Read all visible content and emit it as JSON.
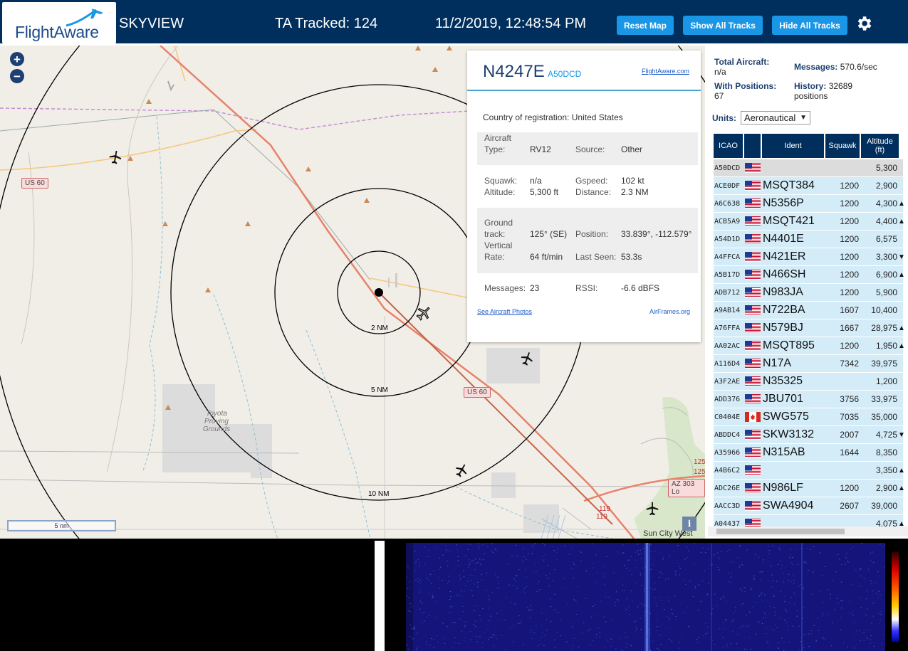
{
  "header": {
    "logo_text": "FlightAware",
    "title": "SKYVIEW",
    "tracked": "TA Tracked: 124",
    "datetime": "11/2/2019, 12:48:54 PM",
    "buttons": {
      "reset": "Reset Map",
      "show": "Show All Tracks",
      "hide": "Hide All Tracks"
    },
    "settings_icon": "gear-icon"
  },
  "map": {
    "zoom_in": "+",
    "zoom_out": "−",
    "range_labels": [
      "2 NM",
      "5 NM",
      "10 NM"
    ],
    "road_labels": [
      "US 60",
      "US 60",
      "AZ 303 Lo",
      "119",
      "119",
      "125",
      "125"
    ],
    "place_labels": [
      "Toyota Proving Grounds",
      "Sun City West"
    ],
    "scale": "5 nm",
    "info": "i"
  },
  "popup": {
    "ident": "N4247E",
    "hex": "A50DCD",
    "link": "FlightAware.com",
    "country_label": "Country of registration:",
    "country": "United States",
    "type_label1": "Aircraft",
    "type_label2": "Type:",
    "type": "RV12",
    "source_label": "Source:",
    "source": "Other",
    "squawk_label": "Squawk:",
    "squawk": "n/a",
    "gspeed_label": "Gspeed:",
    "gspeed": "102 kt",
    "altitude_label": "Altitude:",
    "altitude": "5,300 ft",
    "distance_label": "Distance:",
    "distance": "2.3 NM",
    "track_label1": "Ground",
    "track_label2": "track:",
    "track": "125° (SE)",
    "position_label": "Position:",
    "position": "33.839°, -112.579°",
    "vrate_label1": "Vertical",
    "vrate_label2": "Rate:",
    "vrate": "64 ft/min",
    "lastseen_label": "Last Seen:",
    "lastseen": "53.3s",
    "messages_label": "Messages:",
    "messages": "23",
    "rssi_label": "RSSI:",
    "rssi": "-6.6 dBFS",
    "photos": "See Aircraft Photos",
    "airframes": "AirFrames.org"
  },
  "stats": {
    "total_label": "Total Aircraft:",
    "total": "n/a",
    "messages_label": "Messages:",
    "messages": "570.6/sec",
    "positions_label": "With Positions:",
    "positions": "67",
    "history_label": "History:",
    "history": "32689",
    "history_unit": "positions",
    "units_label": "Units:",
    "units_value": "Aeronautical"
  },
  "table": {
    "headers": {
      "icao": "ICAO",
      "ident": "Ident",
      "squawk": "Squawk",
      "alt1": "Altitude",
      "alt2": "(ft)"
    },
    "rows": [
      {
        "icao": "A50DCD",
        "flag": "us",
        "ident": "",
        "squawk": "",
        "alt": "5,300",
        "trend": ""
      },
      {
        "icao": "ACE0DF",
        "flag": "us",
        "ident": "MSQT384",
        "squawk": "1200",
        "alt": "2,900",
        "trend": ""
      },
      {
        "icao": "A6C638",
        "flag": "us",
        "ident": "N5356P",
        "squawk": "1200",
        "alt": "4,300",
        "trend": "▲"
      },
      {
        "icao": "ACB5A9",
        "flag": "us",
        "ident": "MSQT421",
        "squawk": "1200",
        "alt": "4,400",
        "trend": "▲"
      },
      {
        "icao": "A54D1D",
        "flag": "us",
        "ident": "N4401E",
        "squawk": "1200",
        "alt": "6,575",
        "trend": ""
      },
      {
        "icao": "A4FFCA",
        "flag": "us",
        "ident": "N421ER",
        "squawk": "1200",
        "alt": "3,300",
        "trend": "▼"
      },
      {
        "icao": "A5B17D",
        "flag": "us",
        "ident": "N466SH",
        "squawk": "1200",
        "alt": "6,900",
        "trend": "▲"
      },
      {
        "icao": "ADB712",
        "flag": "us",
        "ident": "N983JA",
        "squawk": "1200",
        "alt": "5,900",
        "trend": ""
      },
      {
        "icao": "A9AB14",
        "flag": "us",
        "ident": "N722BA",
        "squawk": "1607",
        "alt": "10,400",
        "trend": ""
      },
      {
        "icao": "A76FFA",
        "flag": "us",
        "ident": "N579BJ",
        "squawk": "1667",
        "alt": "28,975",
        "trend": "▲"
      },
      {
        "icao": "AA02AC",
        "flag": "us",
        "ident": "MSQT895",
        "squawk": "1200",
        "alt": "1,950",
        "trend": "▲"
      },
      {
        "icao": "A116D4",
        "flag": "us",
        "ident": "N17A",
        "squawk": "7342",
        "alt": "39,975",
        "trend": ""
      },
      {
        "icao": "A3F2AE",
        "flag": "us",
        "ident": "N35325",
        "squawk": "",
        "alt": "1,200",
        "trend": ""
      },
      {
        "icao": "ADD376",
        "flag": "us",
        "ident": "JBU701",
        "squawk": "3756",
        "alt": "33,975",
        "trend": ""
      },
      {
        "icao": "C0404E",
        "flag": "ca",
        "ident": "SWG575",
        "squawk": "7035",
        "alt": "35,000",
        "trend": ""
      },
      {
        "icao": "ABDDC4",
        "flag": "us",
        "ident": "SKW3132",
        "squawk": "2007",
        "alt": "4,725",
        "trend": "▼"
      },
      {
        "icao": "A35966",
        "flag": "us",
        "ident": "N315AB",
        "squawk": "1644",
        "alt": "8,350",
        "trend": ""
      },
      {
        "icao": "A4B6C2",
        "flag": "us",
        "ident": "",
        "squawk": "",
        "alt": "3,350",
        "trend": "▲"
      },
      {
        "icao": "ADC26E",
        "flag": "us",
        "ident": "N986LF",
        "squawk": "1200",
        "alt": "2,900",
        "trend": "▲"
      },
      {
        "icao": "AACC3D",
        "flag": "us",
        "ident": "SWA4904",
        "squawk": "2607",
        "alt": "39,000",
        "trend": ""
      },
      {
        "icao": "A04437",
        "flag": "us",
        "ident": "",
        "squawk": "",
        "alt": "4,075",
        "trend": "▲"
      }
    ]
  },
  "colors": {
    "header_bg": "#002f5d",
    "button": "#1a96e6",
    "row_bg": "#d4ecf8",
    "track_line": "#e8826a"
  }
}
